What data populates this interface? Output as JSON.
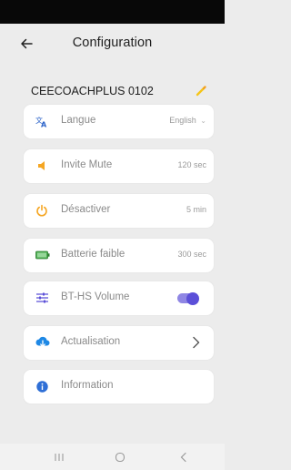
{
  "header": {
    "title": "Configuration"
  },
  "device": {
    "name": "CEECOACHPLUS 0102"
  },
  "settings": [
    {
      "label": "Langue",
      "value": "English",
      "icon": "translate-icon"
    },
    {
      "label": "Invite Mute",
      "value": "120 sec",
      "icon": "speaker-icon"
    },
    {
      "label": "Désactiver",
      "value": "5 min",
      "icon": "power-icon"
    },
    {
      "label": "Batterie faible",
      "value": "300 sec",
      "icon": "battery-icon"
    },
    {
      "label": "BT-HS Volume",
      "icon": "equalizer-icon",
      "toggle_on": true
    },
    {
      "label": "Actualisation",
      "icon": "cloud-download-icon"
    },
    {
      "label": "Information",
      "icon": "info-icon"
    }
  ],
  "colors": {
    "accent": "#5b4fd8",
    "orange": "#f5a623",
    "blue": "#1e88e5",
    "green": "#4caf50"
  },
  "nav": {
    "icons": [
      "recent-apps-icon",
      "home-icon",
      "back-icon"
    ]
  }
}
